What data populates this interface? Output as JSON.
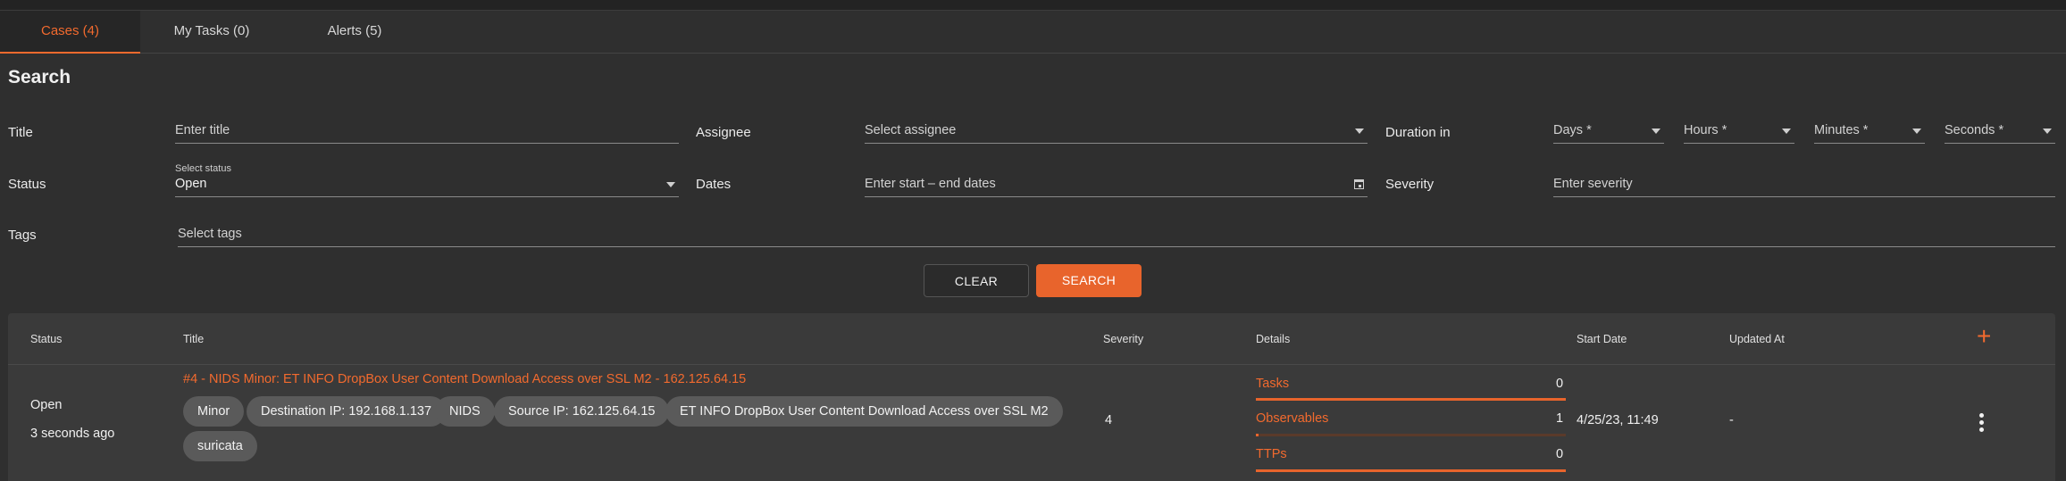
{
  "tabs": [
    {
      "label": "Cases (4)"
    },
    {
      "label": "My Tasks (0)"
    },
    {
      "label": "Alerts (5)"
    }
  ],
  "search": {
    "heading": "Search",
    "title_label": "Title",
    "title_placeholder": "Enter title",
    "assignee_label": "Assignee",
    "assignee_placeholder": "Select assignee",
    "duration_label": "Duration in",
    "days_placeholder": "Days *",
    "hours_placeholder": "Hours *",
    "minutes_placeholder": "Minutes *",
    "seconds_placeholder": "Seconds *",
    "status_label": "Status",
    "status_small_label": "Select status",
    "status_value": "Open",
    "dates_label": "Dates",
    "dates_placeholder": "Enter start – end dates",
    "severity_label": "Severity",
    "severity_placeholder": "Enter severity",
    "tags_label": "Tags",
    "tags_placeholder": "Select tags",
    "clear_label": "CLEAR",
    "search_label": "SEARCH"
  },
  "table": {
    "headers": {
      "status": "Status",
      "title": "Title",
      "severity": "Severity",
      "details": "Details",
      "start_date": "Start Date",
      "updated_at": "Updated At",
      "add": "+"
    },
    "rows": [
      {
        "status": "Open",
        "age": "3 seconds ago",
        "title": "#4 - NIDS Minor: ET INFO DropBox User Content Download Access over SSL M2 - 162.125.64.15",
        "tags": [
          "Minor",
          "Destination IP: 192.168.1.137",
          "NIDS",
          "Source IP: 162.125.64.15",
          "ET INFO DropBox User Content Download Access over SSL M2",
          "suricata"
        ],
        "severity": "4",
        "details": [
          {
            "label": "Tasks",
            "count": "0",
            "progress": 1.0
          },
          {
            "label": "Observables",
            "count": "1",
            "progress": 0.01
          },
          {
            "label": "TTPs",
            "count": "0",
            "progress": 1.0
          }
        ],
        "start_date": "4/25/23, 11:49",
        "updated_at": "-"
      }
    ]
  },
  "colors": {
    "accent": "#f26a2e",
    "background": "#2f2f2f",
    "panel": "#3a3a3a"
  }
}
